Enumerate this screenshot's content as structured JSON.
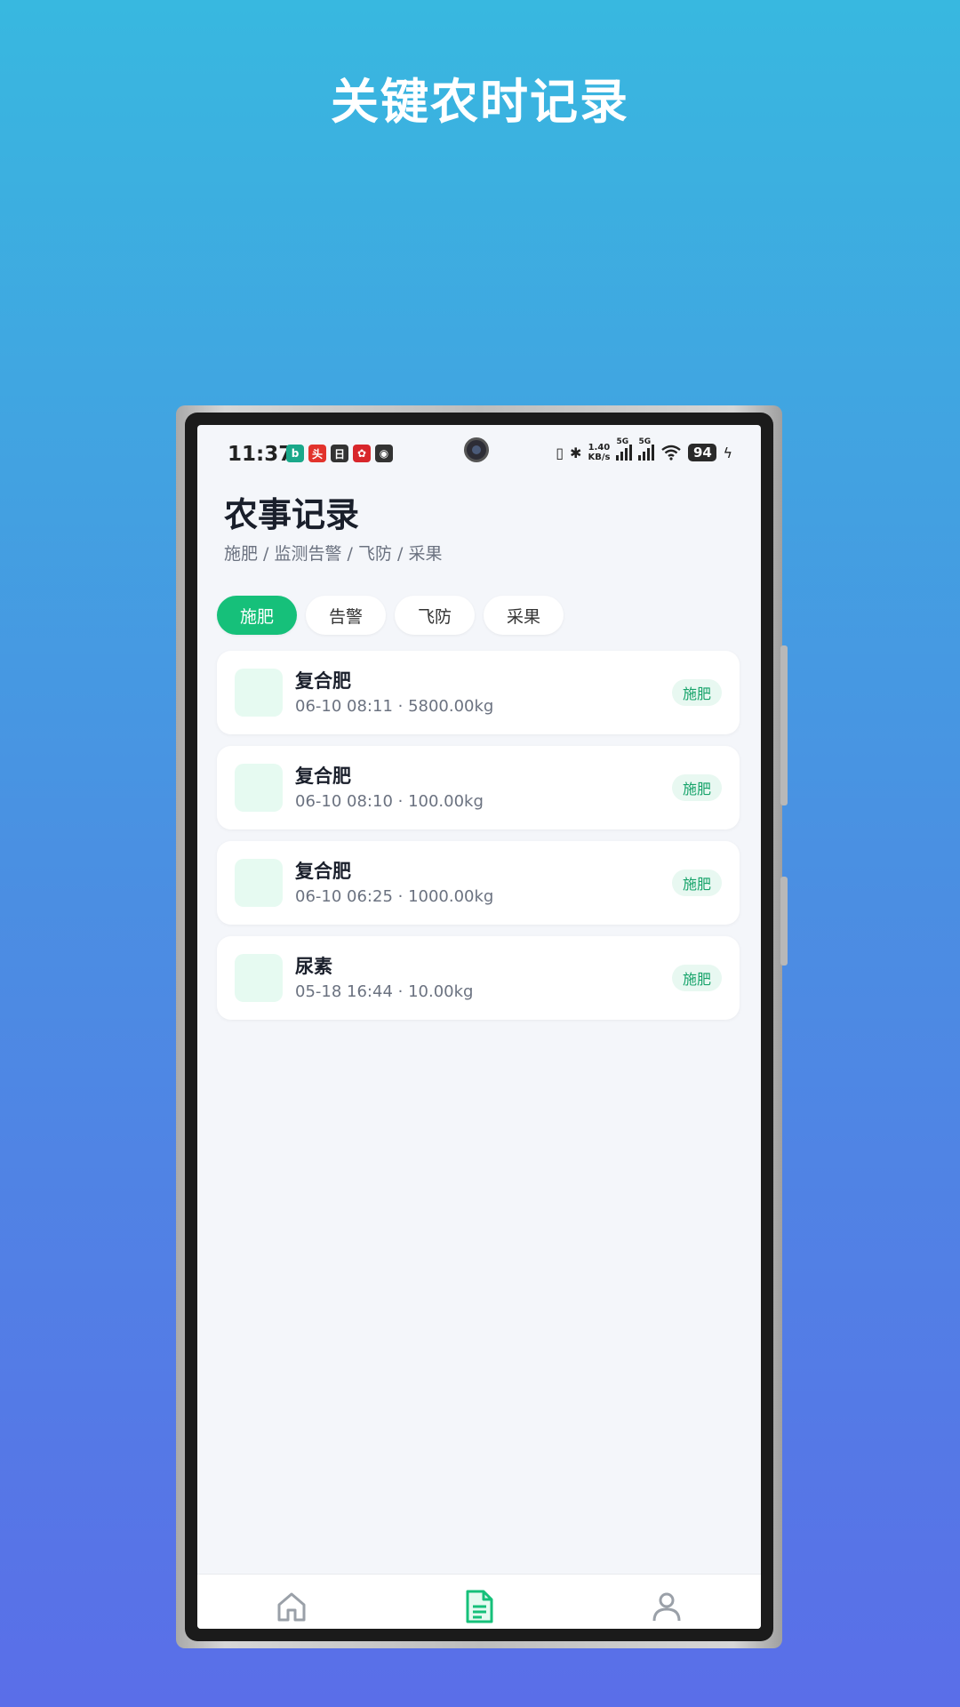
{
  "promo": {
    "title": "关键农时记录"
  },
  "status_bar": {
    "time": "11:37",
    "net_speed_value": "1.40",
    "net_speed_unit": "KB/s",
    "sim1_tag": "5G",
    "sim2_tag": "5G",
    "battery": "94",
    "apps": [
      {
        "name": "b-app-icon",
        "label": "b",
        "color": "#1aa88a"
      },
      {
        "name": "toutiao-app-icon",
        "label": "头",
        "color": "#e2332c"
      },
      {
        "name": "box-app-icon",
        "label": "日",
        "color": "#333333"
      },
      {
        "name": "red-flower-app-icon",
        "label": "✿",
        "color": "#d8262b"
      },
      {
        "name": "round-app-icon",
        "label": "◉",
        "color": "#333333"
      }
    ]
  },
  "header": {
    "title": "农事记录",
    "subtitle": "施肥 / 监测告警 / 飞防 / 采果"
  },
  "tabs": [
    {
      "label": "施肥",
      "active": true
    },
    {
      "label": "告警",
      "active": false
    },
    {
      "label": "飞防",
      "active": false
    },
    {
      "label": "采果",
      "active": false
    }
  ],
  "records": [
    {
      "name": "复合肥",
      "meta": "06-10 08:11 · 5800.00kg",
      "tag": "施肥"
    },
    {
      "name": "复合肥",
      "meta": "06-10 08:10 · 100.00kg",
      "tag": "施肥"
    },
    {
      "name": "复合肥",
      "meta": "06-10 06:25 · 1000.00kg",
      "tag": "施肥"
    },
    {
      "name": "尿素",
      "meta": "05-18 16:44 · 10.00kg",
      "tag": "施肥"
    }
  ],
  "bottom_nav": [
    {
      "icon": "home-icon",
      "active": false
    },
    {
      "icon": "document-icon",
      "active": true
    },
    {
      "icon": "user-icon",
      "active": false
    }
  ],
  "colors": {
    "accent": "#16c07a",
    "tag_text": "#16a36a",
    "tag_bg": "#e8f8f1",
    "nav_inactive": "#9aa0a8"
  }
}
